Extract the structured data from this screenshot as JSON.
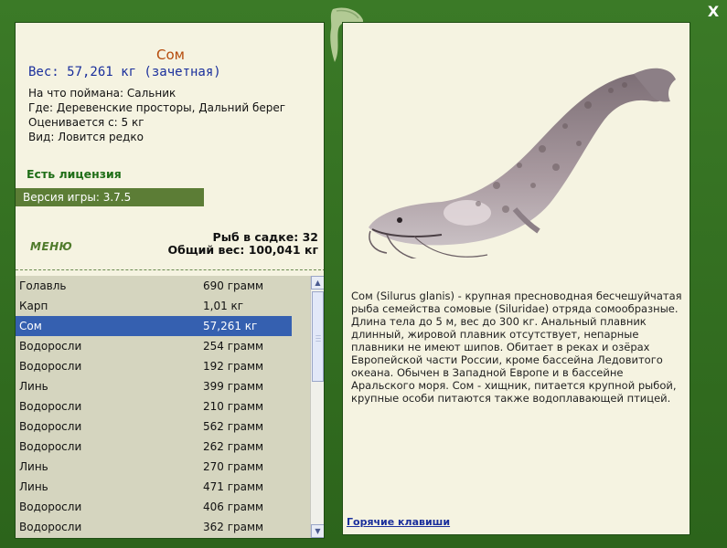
{
  "window": {
    "close_label": "X"
  },
  "catch": {
    "name": "Сом",
    "weight": "Вес: 57,261 кг (зачетная)",
    "bait": "На что поймана: Сальник",
    "place": "Где: Деревенские просторы, Дальний берег",
    "evaluated": "Оценивается с: 5 кг",
    "kind": "Вид: Ловится редко"
  },
  "license": "Есть лицензия",
  "version": "Версия игры: 3.7.5",
  "menu_label": "МЕНЮ",
  "stats": {
    "count": "Рыб в садке: 32",
    "total": "Общий вес: 100,041 кг"
  },
  "fish_list": [
    {
      "name": "Голавль",
      "weight": "690 грамм"
    },
    {
      "name": "Карп",
      "weight": "1,01 кг"
    },
    {
      "name": "Сом",
      "weight": "57,261 кг",
      "selected": true
    },
    {
      "name": "Водоросли",
      "weight": "254 грамм"
    },
    {
      "name": "Водоросли",
      "weight": "192 грамм"
    },
    {
      "name": "Линь",
      "weight": "399 грамм"
    },
    {
      "name": "Водоросли",
      "weight": "210 грамм"
    },
    {
      "name": "Водоросли",
      "weight": "562 грамм"
    },
    {
      "name": "Водоросли",
      "weight": "262 грамм"
    },
    {
      "name": "Линь",
      "weight": "270 грамм"
    },
    {
      "name": "Линь",
      "weight": "471 грамм"
    },
    {
      "name": "Водоросли",
      "weight": "406 грамм"
    },
    {
      "name": "Водоросли",
      "weight": "362 грамм"
    }
  ],
  "description": "Сом (Silurus glanis) - крупная пресноводная бесчешуйчатая рыба семейства сомовые (Siluridae) отряда сомообразные. Длина тела до 5 м, вес до 300 кг. Анальный плавник длинный, жировой плавник отсутствует, непарные плавники не имеют шипов. Обитает в реках и озёрах Европейской части России, кроме бассейна Ледовитого океана. Обычен в Западной Европе и в бассейне Аральского моря. Сом - хищник, питается крупной рыбой, крупные особи питаются также водоплавающей птицей.",
  "hotkeys_label": "Горячие клавиши",
  "colors": {
    "frame": "#2f6a1f",
    "panel": "#f5f3e1",
    "selection": "#3560b0",
    "title": "#b54a0a",
    "weight": "#1a2f9c"
  }
}
